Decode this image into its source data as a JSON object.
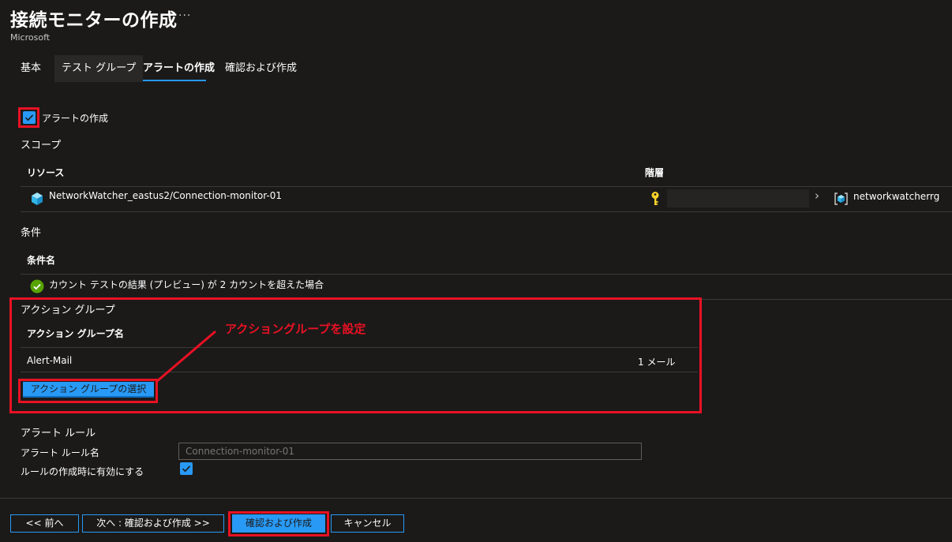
{
  "header": {
    "title": "接続モニターの作成",
    "more": "···",
    "publisher": "Microsoft"
  },
  "tabs": [
    {
      "label": "基本"
    },
    {
      "label": "テスト グループ"
    },
    {
      "label": "アラートの作成"
    },
    {
      "label": "確認および作成"
    }
  ],
  "create_alert": {
    "label": "アラートの作成",
    "checked": true
  },
  "scope": {
    "label": "スコープ",
    "col_resource": "リソース",
    "col_hierarchy": "階層",
    "resource_name": "NetworkWatcher_eastus2/Connection-monitor-01",
    "hierarchy_sep": "›",
    "resource_group": "networkwatcherrg"
  },
  "conditions": {
    "label": "条件",
    "col_name": "条件名",
    "condition_text": "カウント テストの結果 (プレビュー) が 2 カウントを超えた場合"
  },
  "action_group": {
    "label": "アクション グループ",
    "col_name": "アクション グループ名",
    "row_name": "Alert-Mail",
    "row_value": "1 メール",
    "select_button": "アクション グループの選択"
  },
  "annotation": "アクショングループを設定",
  "alert_rule": {
    "label": "アラート ルール",
    "name_label": "アラート ルール名",
    "name_placeholder": "Connection-monitor-01",
    "enable_label": "ルールの作成時に有効にする"
  },
  "footer": {
    "prev": "<< 前へ",
    "next": "次へ : 確認および作成 >>",
    "review": "確認および作成",
    "cancel": "キャンセル"
  },
  "colors": {
    "accent": "#2899f5",
    "highlight_red": "#e81123",
    "background": "#1b1a19",
    "success_green": "#57a300",
    "key_yellow": "#f8d22a"
  }
}
